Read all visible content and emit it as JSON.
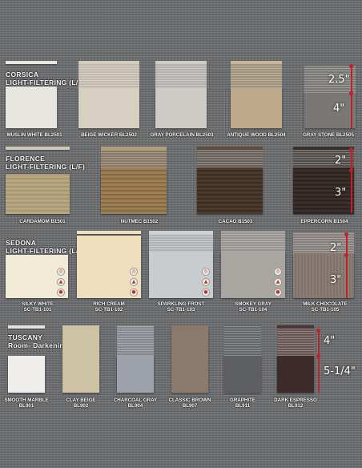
{
  "sections": {
    "corsica": {
      "line1": "CORSICA",
      "line2": "LIGHT-FILTERING (L/F)"
    },
    "florence": {
      "line1": "FLORENCE",
      "line2": "LIGHT-FILTERING (L/F)"
    },
    "sedona": {
      "line1": "SEDONA",
      "line2": "LIGHT-FILTERING (L/F)"
    },
    "tuscany": {
      "line1": "TUSCANY",
      "line2": "Room- Darkening"
    }
  },
  "corsica_swatches": [
    {
      "label": "MUSLIN WHITE BL2501",
      "color": "#e6e5df"
    },
    {
      "label": "BEIGE WICKER BL2502",
      "color": "#d7cfc1"
    },
    {
      "label": "GRAY PORCELAIN BL2503",
      "color": "#cfccc7"
    },
    {
      "label": "ANTIQUE WOOD BL2504",
      "color": "#bda98a"
    },
    {
      "label": "GRAY STONE BL2505",
      "color": "#7a7875"
    }
  ],
  "florence_swatches": [
    {
      "label": "CARDAMOM B1501",
      "color": "#b7a784"
    },
    {
      "label": "NUTMEC B1502",
      "color": "#9c7f56"
    },
    {
      "label": "CACAO B1503",
      "color": "#4c3a2c"
    },
    {
      "label": "EPPERCORN B1504",
      "color": "#2f2622"
    }
  ],
  "sedona_swatches": [
    {
      "line1": "SILKY WHITE",
      "line2": "SC-TB1-101",
      "color": "#f1ead6"
    },
    {
      "line1": "RICH CREAM",
      "line2": "SC-TB1-102",
      "color": "#f0dfbf"
    },
    {
      "line1": "SPARKLING FROST",
      "line2": "SC-TB1-103",
      "color": "#c9cccf"
    },
    {
      "line1": "SMOKEY GRAY",
      "line2": "SC-TB1-104",
      "color": "#a9a6a2"
    },
    {
      "line1": "MILK CHOCOLATE",
      "line2": "SC-TB1-105",
      "color": "#8a7e76"
    }
  ],
  "tuscany_swatches": [
    {
      "line1": "SMOOTH MARBLE",
      "line2": "BL901",
      "color": "#f0eeea"
    },
    {
      "line1": "CLAY BEIGE",
      "line2": "BL902",
      "color": "#cfc3a6"
    },
    {
      "line1": "CHARCOAL GRAY",
      "line2": "BL904",
      "color": "#9ea2ad"
    },
    {
      "line1": "CLASSIC BROWN",
      "line2": "BL907",
      "color": "#8b7b6c"
    },
    {
      "line1": "GRAPHITE",
      "line2": "BL911",
      "color": "#5e5f61"
    },
    {
      "line1": "DARK ESPRESSO",
      "line2": "BL912",
      "color": "#3d2b2a"
    }
  ],
  "dimensions": {
    "corsica_top": "2.5\"",
    "corsica_bottom": "4\"",
    "florence_top": "2\"",
    "florence_bottom": "3\"",
    "sedona_top": "2\"",
    "sedona_bottom": "3\"",
    "tuscany_top": "4\"",
    "tuscany_bottom": "5-1/4\""
  },
  "accent_color": "#c0202a"
}
